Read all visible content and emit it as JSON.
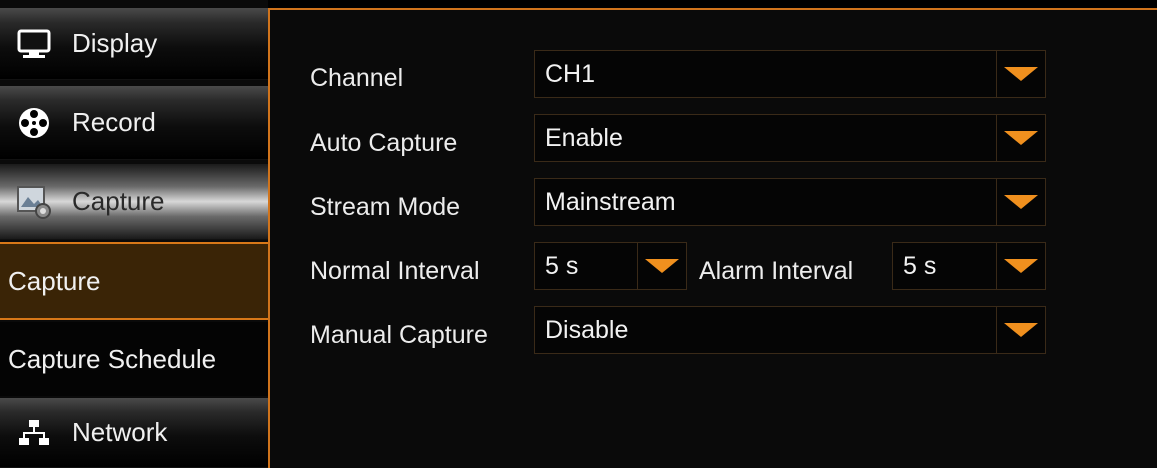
{
  "sidebar": {
    "items": [
      {
        "label": "Display",
        "icon": "monitor-icon"
      },
      {
        "label": "Record",
        "icon": "film-reel-icon"
      },
      {
        "label": "Capture",
        "icon": "capture-image-icon"
      },
      {
        "label": "Capture"
      },
      {
        "label": "Capture Schedule"
      },
      {
        "label": "Network",
        "icon": "network-icon"
      }
    ]
  },
  "form": {
    "channel": {
      "label": "Channel",
      "value": "CH1"
    },
    "auto_capture": {
      "label": "Auto Capture",
      "value": "Enable"
    },
    "stream_mode": {
      "label": "Stream Mode",
      "value": "Mainstream"
    },
    "normal_interval": {
      "label": "Normal Interval",
      "value": "5 s"
    },
    "alarm_interval": {
      "label": "Alarm Interval",
      "value": "5 s"
    },
    "manual_capture": {
      "label": "Manual Capture",
      "value": "Disable"
    }
  },
  "colors": {
    "accent": "#d0741c",
    "arrow": "#f0901e",
    "selected_bg": "#3a2406"
  }
}
